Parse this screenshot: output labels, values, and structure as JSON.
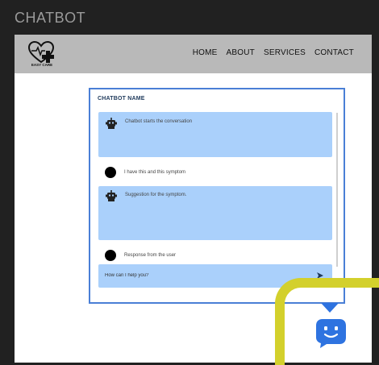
{
  "page": {
    "title": "CHATBOT"
  },
  "brand": {
    "logo_text": "EASY CARE"
  },
  "nav": {
    "items": [
      "HOME",
      "ABOUT",
      "SERVICES",
      "CONTACT"
    ]
  },
  "chat": {
    "name": "CHATBOT NAME",
    "messages": [
      {
        "from": "bot",
        "text": "Chatbot starts the conversation"
      },
      {
        "from": "user",
        "text": "I have this and this symptom"
      },
      {
        "from": "bot",
        "text": "Suggestion for the symptom."
      },
      {
        "from": "user",
        "text": "Response from the user"
      }
    ],
    "input_placeholder": "How can I help you?"
  },
  "colors": {
    "accent": "#2e73e0",
    "bubble": "#aad0fb",
    "highlight": "#d3d02c",
    "navbar": "#b9b9b9"
  },
  "icons": {
    "bot": "robot-icon",
    "send": "send-icon",
    "launcher": "chat-bubble-smile-icon"
  }
}
